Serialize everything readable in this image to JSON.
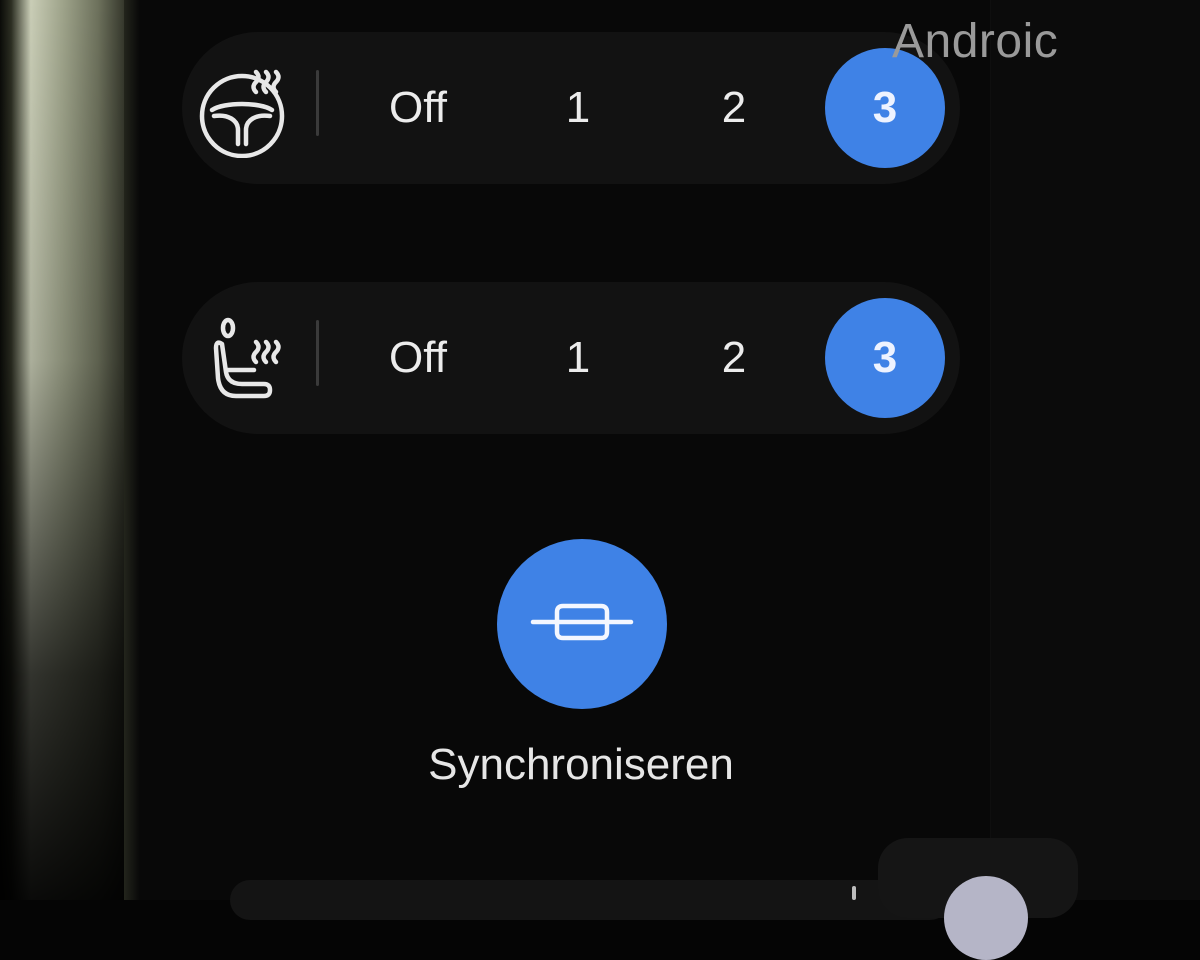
{
  "side_panel": {
    "title": "Androic"
  },
  "steering_heat": {
    "icon": "heated-steering-wheel-icon",
    "options": [
      "Off",
      "1",
      "2",
      "3"
    ],
    "selected": "3"
  },
  "seat_heat": {
    "icon": "heated-seat-icon",
    "options": [
      "Off",
      "1",
      "2",
      "3"
    ],
    "selected": "3"
  },
  "sync": {
    "icon": "sync-link-icon",
    "label": "Synchroniseren"
  },
  "colors": {
    "accent": "#3f82e6",
    "background": "#080808",
    "row_background": "#121212",
    "text": "#ececec"
  }
}
